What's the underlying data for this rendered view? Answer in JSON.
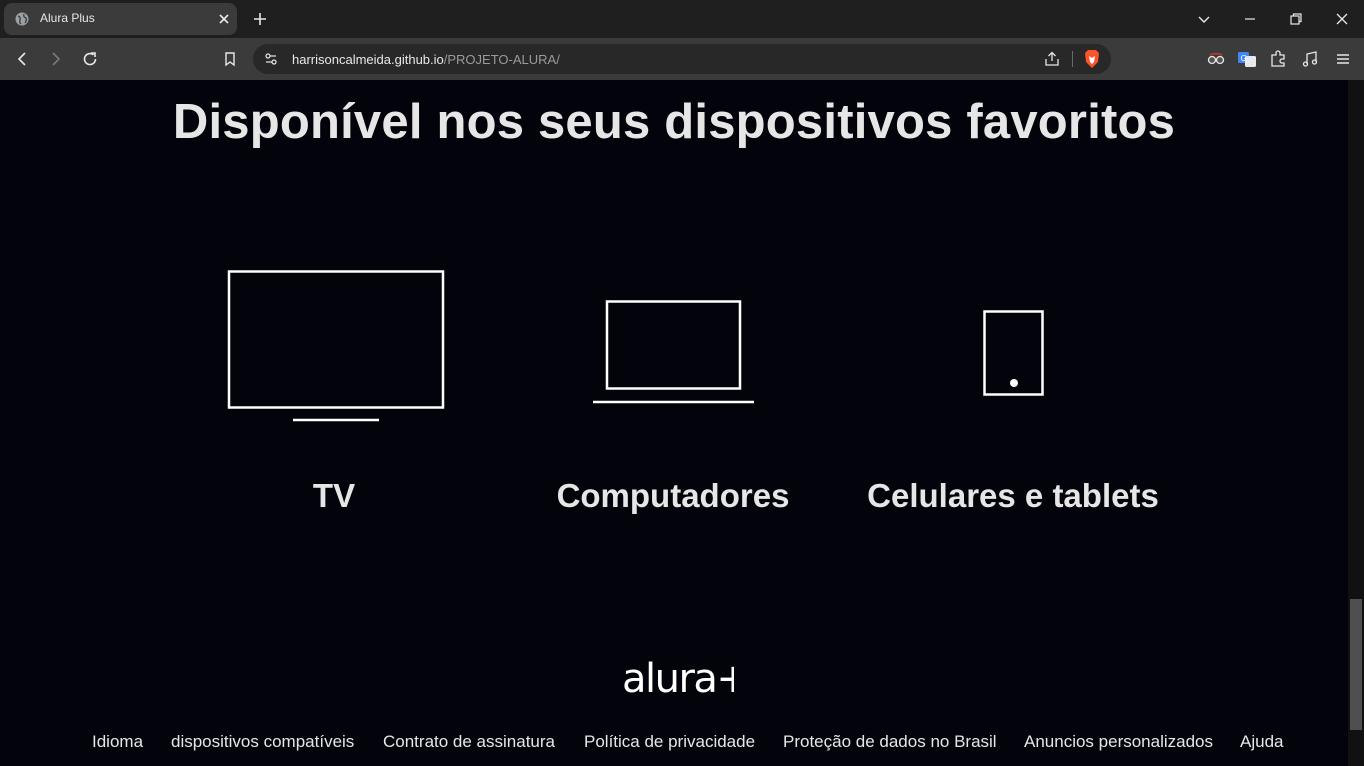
{
  "browser": {
    "tab_title": "Alura Plus",
    "url_host": "harrisoncalmeida.github.io",
    "url_path": "/PROJETO-ALURA/"
  },
  "page": {
    "headline": "Disponível nos seus dispositivos favoritos",
    "devices": [
      {
        "label": "TV",
        "icon": "tv-icon"
      },
      {
        "label": "Computadores",
        "icon": "laptop-icon"
      },
      {
        "label": "Celulares e tablets",
        "icon": "tablet-icon"
      }
    ],
    "logo_text": "alura+",
    "footer_links": [
      "Idioma",
      "dispositivos compatíveis",
      "Contrato de assinatura",
      "Política de privacidade",
      "Proteção de dados no Brasil",
      "Anuncios personalizados",
      "Ajuda"
    ]
  },
  "colors": {
    "page_background": "#03040b",
    "text": "#e6e6e6",
    "icon_stroke": "#ffffff",
    "chrome_dark": "#1f1f1f",
    "chrome_light": "#3b3b3b"
  }
}
